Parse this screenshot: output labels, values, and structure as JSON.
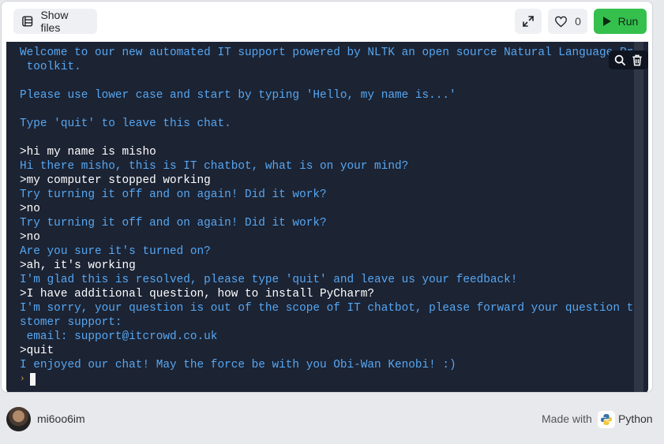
{
  "toolbar": {
    "show_files_label": "Show files",
    "like_count": "0",
    "run_label": "Run"
  },
  "console": {
    "lines": [
      {
        "type": "out",
        "text": "Welcome to our new automated IT support powered by NLTK an open source Natural Language Processing"
      },
      {
        "type": "out",
        "text": " toolkit."
      },
      {
        "type": "blank",
        "text": ""
      },
      {
        "type": "out",
        "text": "Please use lower case and start by typing 'Hello, my name is...'"
      },
      {
        "type": "blank",
        "text": ""
      },
      {
        "type": "out",
        "text": "Type 'quit' to leave this chat."
      },
      {
        "type": "blank",
        "text": ""
      },
      {
        "type": "in",
        "text": ">hi my name is misho"
      },
      {
        "type": "out",
        "text": "Hi there misho, this is IT chatbot, what is on your mind?"
      },
      {
        "type": "in",
        "text": ">my computer stopped working"
      },
      {
        "type": "out",
        "text": "Try turning it off and on again! Did it work?"
      },
      {
        "type": "in",
        "text": ">no"
      },
      {
        "type": "out",
        "text": "Try turning it off and on again! Did it work?"
      },
      {
        "type": "in",
        "text": ">no"
      },
      {
        "type": "out",
        "text": "Are you sure it's turned on?"
      },
      {
        "type": "in",
        "text": ">ah, it's working"
      },
      {
        "type": "out",
        "text": "I'm glad this is resolved, please type 'quit' and leave us your feedback!"
      },
      {
        "type": "in",
        "text": ">I have additional question, how to install PyCharm?"
      },
      {
        "type": "out",
        "text": "I'm sorry, your question is out of the scope of IT chatbot, please forward your question to our cu"
      },
      {
        "type": "out",
        "text": "stomer support:"
      },
      {
        "type": "out",
        "text": " email: support@itcrowd.co.uk"
      },
      {
        "type": "in",
        "text": ">quit"
      },
      {
        "type": "out",
        "text": "I enjoyed our chat! May the force be with you Obi-Wan Kenobi! :)"
      }
    ],
    "prompt_symbol": "›"
  },
  "footer": {
    "username": "mi6oo6im",
    "made_with": "Made with",
    "language": "Python"
  },
  "colors": {
    "console_bg": "#1c2333",
    "output_text": "#56a7f2",
    "input_text": "#ffffff",
    "run_button": "#35c04e"
  },
  "icons": {
    "files": "file-list-icon",
    "expand": "expand-icon",
    "like": "heart-icon",
    "run": "play-icon",
    "search": "search-icon",
    "clear": "trash-icon",
    "python": "python-logo"
  }
}
